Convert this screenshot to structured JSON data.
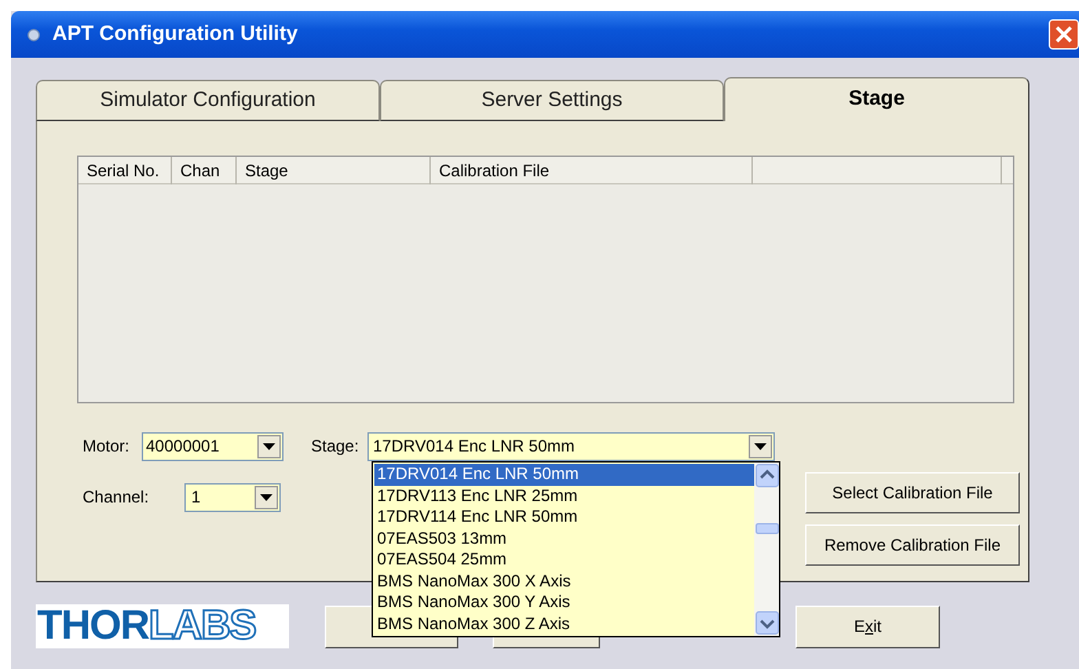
{
  "window": {
    "title": "APT Configuration Utility"
  },
  "tabs": [
    {
      "label": "Simulator Configuration",
      "selected": false
    },
    {
      "label": "Server Settings",
      "selected": false
    },
    {
      "label": "Stage",
      "selected": true
    }
  ],
  "table": {
    "columns": [
      "Serial No.",
      "Chan",
      "Stage",
      "Calibration File"
    ]
  },
  "motor": {
    "label": "Motor:",
    "value": "40000001"
  },
  "channel": {
    "label": "Channel:",
    "value": "1"
  },
  "stage": {
    "label": "Stage:",
    "value": "17DRV014 Enc LNR 50mm",
    "expanded": true,
    "options": [
      {
        "label": "17DRV014 Enc LNR 50mm",
        "selected": true
      },
      {
        "label": "17DRV113 Enc LNR 25mm",
        "selected": false
      },
      {
        "label": "17DRV114 Enc LNR 50mm",
        "selected": false
      },
      {
        "label": "07EAS503 13mm",
        "selected": false
      },
      {
        "label": "07EAS504 25mm",
        "selected": false
      },
      {
        "label": "BMS NanoMax 300 X Axis",
        "selected": false
      },
      {
        "label": "BMS NanoMax 300 Y Axis",
        "selected": false
      },
      {
        "label": "BMS NanoMax 300 Z Axis",
        "selected": false
      }
    ]
  },
  "side_buttons": [
    "Select Calibration File",
    "Remove Calibration File"
  ],
  "logo": {
    "dark": "THOR",
    "light": "LABS"
  },
  "exit_button": {
    "label": "Exit",
    "access_key_underlined": true
  }
}
